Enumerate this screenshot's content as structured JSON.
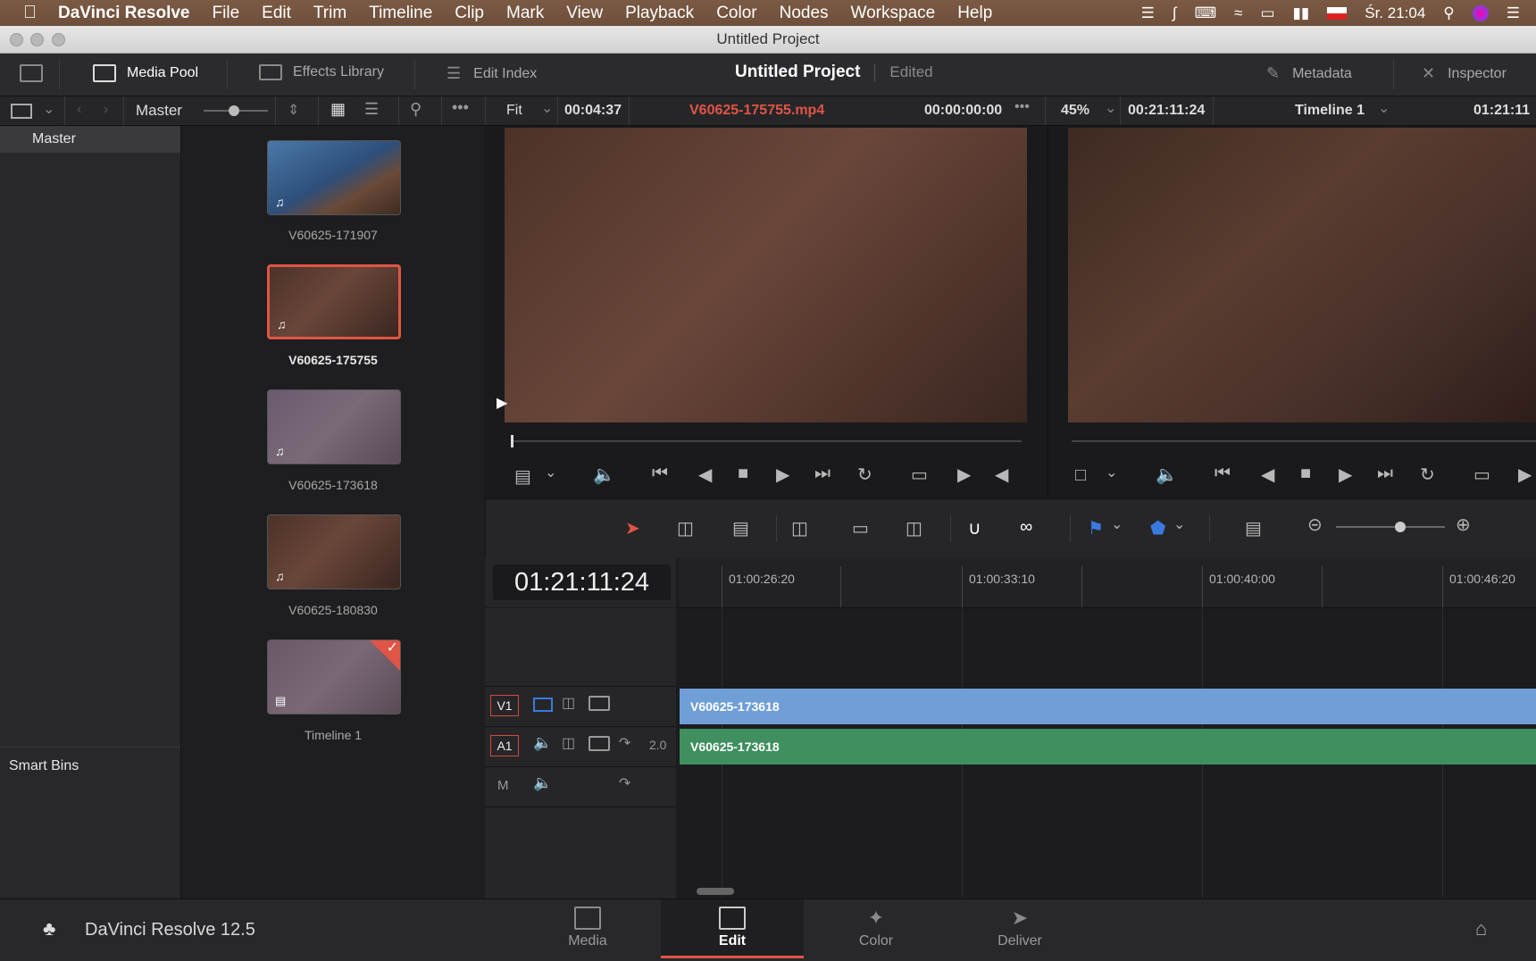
{
  "menubar": {
    "app_name": "DaVinci Resolve",
    "menus": [
      "File",
      "Edit",
      "Trim",
      "Timeline",
      "Clip",
      "Mark",
      "View",
      "Playback",
      "Color",
      "Nodes",
      "Workspace",
      "Help"
    ],
    "clock": "Śr. 21:04"
  },
  "window": {
    "title": "Untitled Project"
  },
  "toolbar": {
    "media_pool": "Media Pool",
    "effects_library": "Effects Library",
    "edit_index": "Edit Index",
    "project_name": "Untitled Project",
    "project_state": "Edited",
    "metadata": "Metadata",
    "inspector": "Inspector"
  },
  "subbar": {
    "bin_name": "Master",
    "source_zoom": "Fit",
    "source_duration": "00:04:37",
    "source_clip": "V60625-175755.mp4",
    "source_timecode": "00:00:00:00",
    "timeline_zoom": "45%",
    "timeline_duration": "00:21:11:24",
    "timeline_name": "Timeline 1",
    "timeline_timecode": "01:21:11"
  },
  "bins": {
    "master": "Master",
    "smart_bins": "Smart Bins"
  },
  "pool": {
    "items": [
      {
        "name": "V60625-171907",
        "selected": false
      },
      {
        "name": "V60625-175755",
        "selected": true
      },
      {
        "name": "V60625-173618",
        "selected": false
      },
      {
        "name": "V60625-180830",
        "selected": false
      },
      {
        "name": "Timeline 1",
        "selected": false
      }
    ]
  },
  "timeline": {
    "timecode": "01:21:11:24",
    "ruler": [
      "01:00:26:20",
      "01:00:33:10",
      "01:00:40:00",
      "01:00:46:20"
    ],
    "tracks": {
      "v1": "V1",
      "a1": "A1",
      "a1_channels": "2.0",
      "m": "M"
    },
    "video_clip": "V60625-173618",
    "audio_clip": "V60625-173618"
  },
  "bottom": {
    "product": "DaVinci Resolve 12.5",
    "pages": [
      "Media",
      "Edit",
      "Color",
      "Deliver"
    ],
    "active_page": "Edit"
  },
  "colors": {
    "accent": "#e05545",
    "video_clip": "#6f9fd6",
    "audio_clip": "#3f8f5f"
  }
}
